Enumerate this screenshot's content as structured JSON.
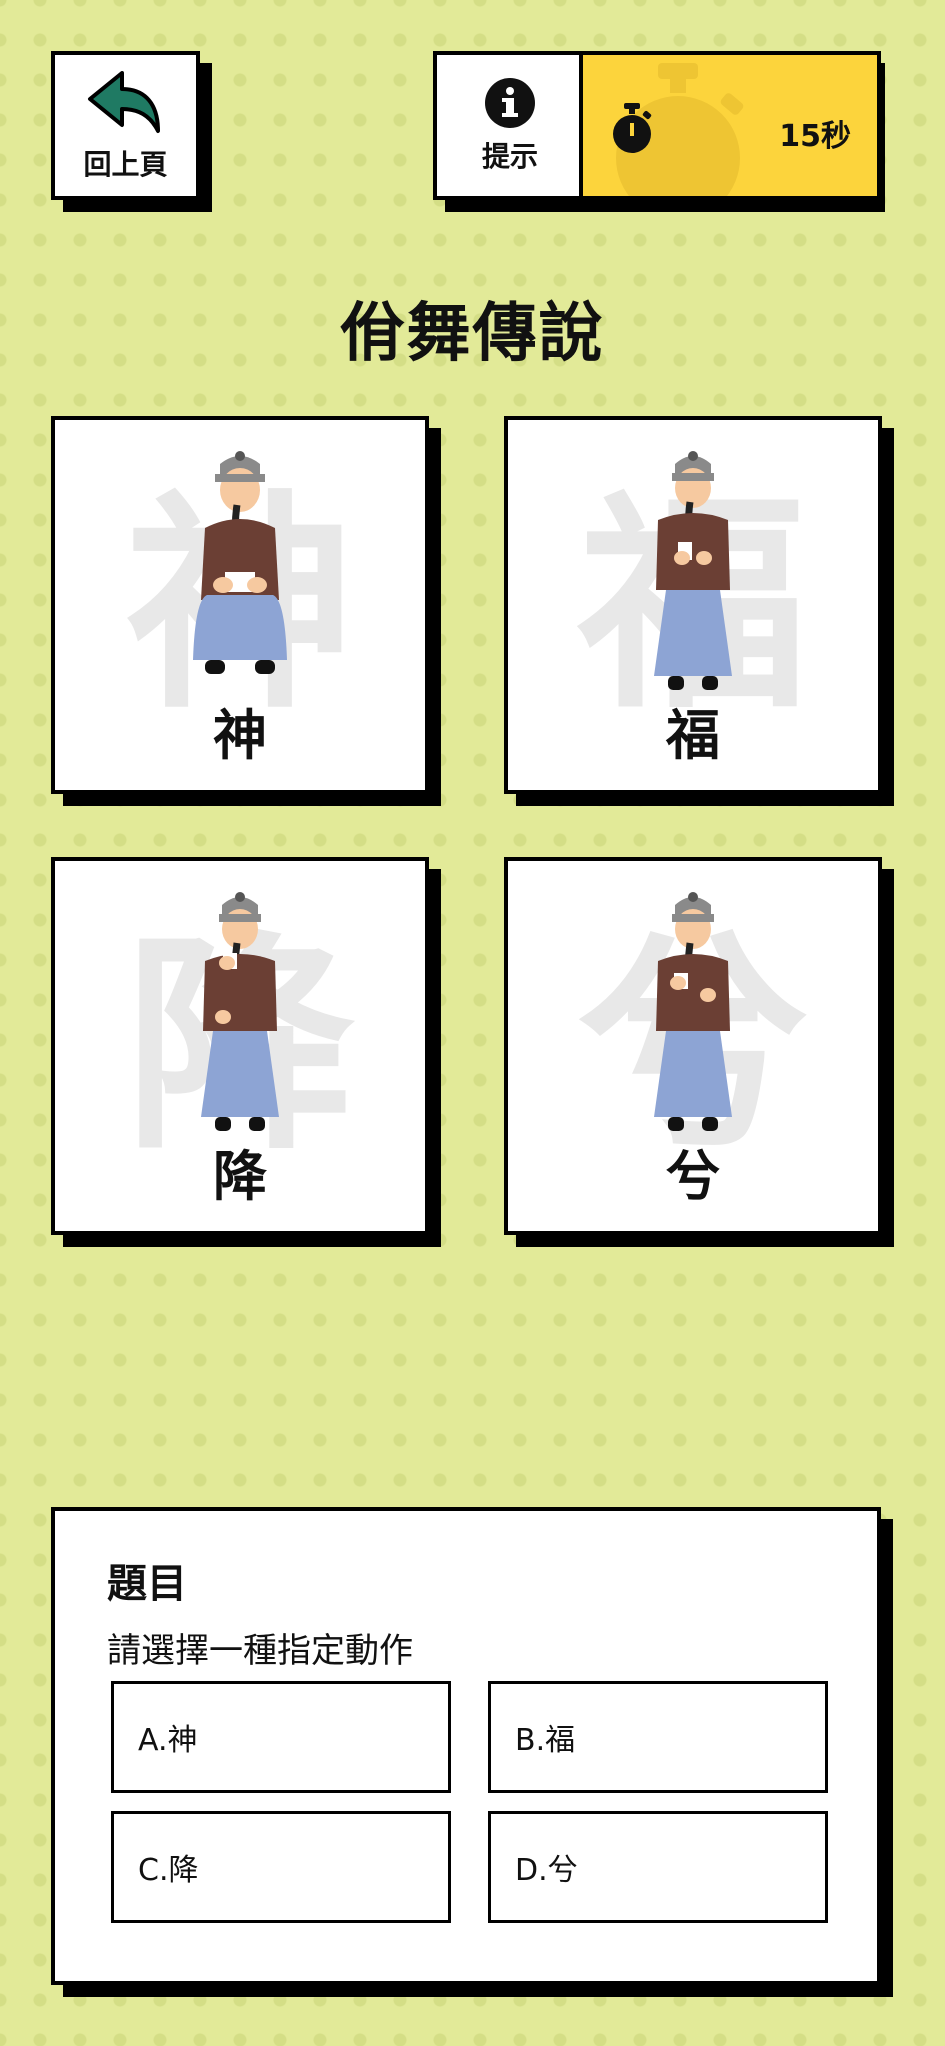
{
  "header": {
    "back_label": "回上頁",
    "hint_label": "提示",
    "timer_text": "15秒"
  },
  "title": "佾舞傳說",
  "cards": [
    {
      "char": "神",
      "label": "神",
      "pose": "seated"
    },
    {
      "char": "福",
      "label": "福",
      "pose": "standing-hands-front"
    },
    {
      "char": "降",
      "label": "降",
      "pose": "standing-hand-raised"
    },
    {
      "char": "兮",
      "label": "兮",
      "pose": "standing-hand-raised"
    }
  ],
  "question": {
    "heading": "題目",
    "prompt": "請選擇一種指定動作",
    "options": [
      "A.神",
      "B.福",
      "C.降",
      "D.兮"
    ]
  },
  "colors": {
    "background": "#e2ea98",
    "timer": "#fcd43c",
    "back_arrow": "#1f7a63"
  },
  "icons": {
    "back": "back-arrow-icon",
    "hint": "info-icon",
    "timer": "stopwatch-icon"
  }
}
